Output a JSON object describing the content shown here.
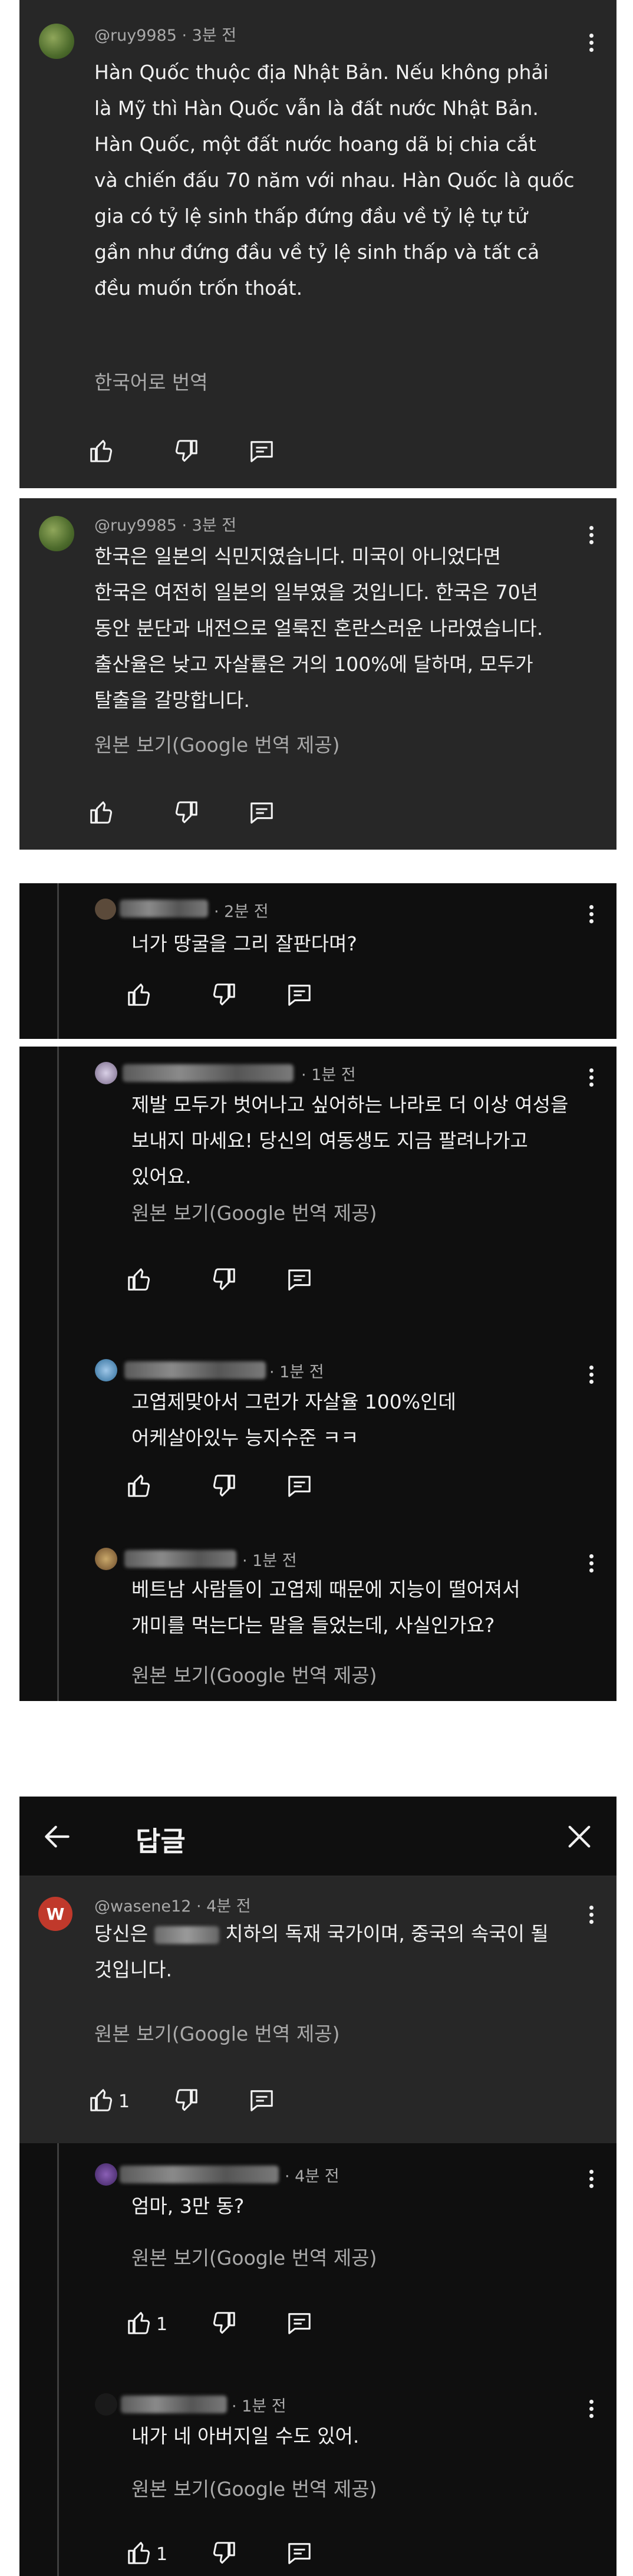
{
  "comment1": {
    "author": "@ruy9985",
    "time": "3분 전",
    "text_lines": [
      "Hàn Quốc thuộc địa Nhật Bản. Nếu không phải",
      "là Mỹ thì Hàn Quốc vẫn là đất nước Nhật Bản.",
      "Hàn Quốc, một đất nước hoang dã bị chia cắt",
      "và chiến đấu 70 năm với nhau. Hàn Quốc là quốc",
      "gia có tỷ lệ sinh thấp đứng đầu về tỷ lệ tự tử",
      "gần như đứng đầu về tỷ lệ sinh thấp và tất cả",
      "đều muốn trốn thoát."
    ],
    "translate": "한국어로 번역"
  },
  "comment2": {
    "author": "@ruy9985",
    "time": "3분 전",
    "text_lines": [
      "한국은 일본의 식민지였습니다. 미국이 아니었다면",
      "한국은 여전히 일본의 일부였을 것입니다. 한국은 70년",
      "동안 분단과 내전으로 얼룩진 혼란스러운 나라였습니다.",
      "출산율은 낮고 자살률은 거의 100%에 달하며, 모두가",
      "탈출을 갈망합니다."
    ],
    "translate": "원본 보기(Google 번역 제공)"
  },
  "reply1": {
    "time": "2분 전",
    "text_lines": [
      "너가 땅굴을 그리 잘판다며?"
    ]
  },
  "reply2": {
    "time": "1분 전",
    "text_lines": [
      "제발 모두가 벗어나고 싶어하는 나라로 더 이상 여성을",
      "보내지 마세요! 당신의 여동생도 지금 팔려나가고",
      "있어요."
    ],
    "translate": "원본 보기(Google 번역 제공)"
  },
  "reply3": {
    "time": "1분 전",
    "text_lines": [
      "고엽제맞아서 그런가 자살율 100%인데",
      "어케살아있누 능지수준 ㅋㅋ"
    ]
  },
  "reply4": {
    "time": "1분 전",
    "text_lines": [
      "베트남 사람들이 고엽제 때문에 지능이 떨어져서",
      "개미를 먹는다는 말을 들었는데, 사실인가요?"
    ],
    "translate": "원본 보기(Google 번역 제공)"
  },
  "replies_header": {
    "title": "답글"
  },
  "main_comment": {
    "avatar_letter": "W",
    "author": "@wasene12",
    "time": "4분 전",
    "text_line1_prefix": "당신은",
    "text_line1_suffix": "치하의 독재 국가이며, 중국의 속국이 될",
    "text_line2": "것입니다.",
    "translate": "원본 보기(Google 번역 제공)",
    "like_count": "1"
  },
  "reply5": {
    "time": "4분 전",
    "text_lines": [
      "엄마, 3만 동?"
    ],
    "translate": "원본 보기(Google 번역 제공)",
    "like_count": "1"
  },
  "reply6": {
    "time": "1분 전",
    "text_lines": [
      "내가 네 아버지일 수도 있어."
    ],
    "translate": "원본 보기(Google 번역 제공)",
    "like_count": "1"
  },
  "icons": [
    "like-icon",
    "dislike-icon",
    "reply-icon",
    "more-icon",
    "back-arrow-icon",
    "close-icon"
  ],
  "colors": {
    "panel_dark": "#272727",
    "panel_black": "#0f0f0f",
    "text": "#f1f1f1",
    "secondary": "#aaaaaa",
    "avatar_red": "#c0392b"
  }
}
